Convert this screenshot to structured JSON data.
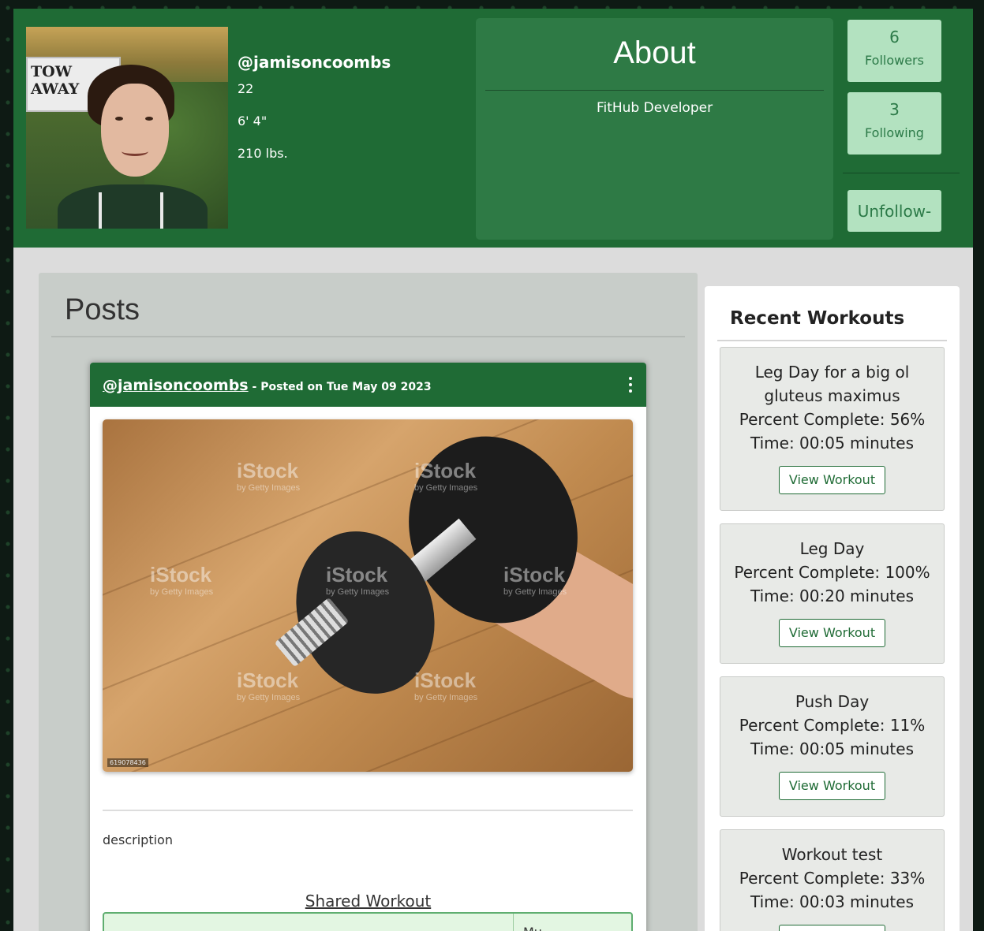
{
  "profile": {
    "handle": "@jamisoncoombs",
    "age": "22",
    "height": "6' 4\"",
    "weight": "210 lbs.",
    "avatar_sign_text": "TOW AWAY"
  },
  "about": {
    "title": "About",
    "bio": "FitHub Developer"
  },
  "followers": {
    "count": "6",
    "label": "Followers"
  },
  "following": {
    "count": "3",
    "label": "Following"
  },
  "unfollow_label": "Unfollow-",
  "posts": {
    "title": "Posts",
    "post": {
      "author": "@jamisoncoombs",
      "dash": " - ",
      "date": "Posted on Tue May 09 2023",
      "image_watermark": "iStock",
      "image_watermark_sub": "by Getty Images",
      "image_code": "619078436",
      "description": "description",
      "shared_label": "Shared Workout",
      "shared_cell": "Mu..."
    }
  },
  "recent": {
    "title": "Recent Workouts",
    "view_label": "View Workout",
    "items": [
      {
        "name": "Leg Day for a big ol gluteus maximus",
        "percent": "Percent Complete: 56%",
        "time": "Time: 00:05 minutes"
      },
      {
        "name": "Leg Day",
        "percent": "Percent Complete: 100%",
        "time": "Time: 00:20 minutes"
      },
      {
        "name": "Push Day",
        "percent": "Percent Complete: 11%",
        "time": "Time: 00:05 minutes"
      },
      {
        "name": "Workout test",
        "percent": "Percent Complete: 33%",
        "time": "Time: 00:03 minutes"
      }
    ]
  },
  "colors": {
    "header_green": "#1f6b35",
    "light_green": "#b3e2c0",
    "about_green": "#2e7a45"
  }
}
